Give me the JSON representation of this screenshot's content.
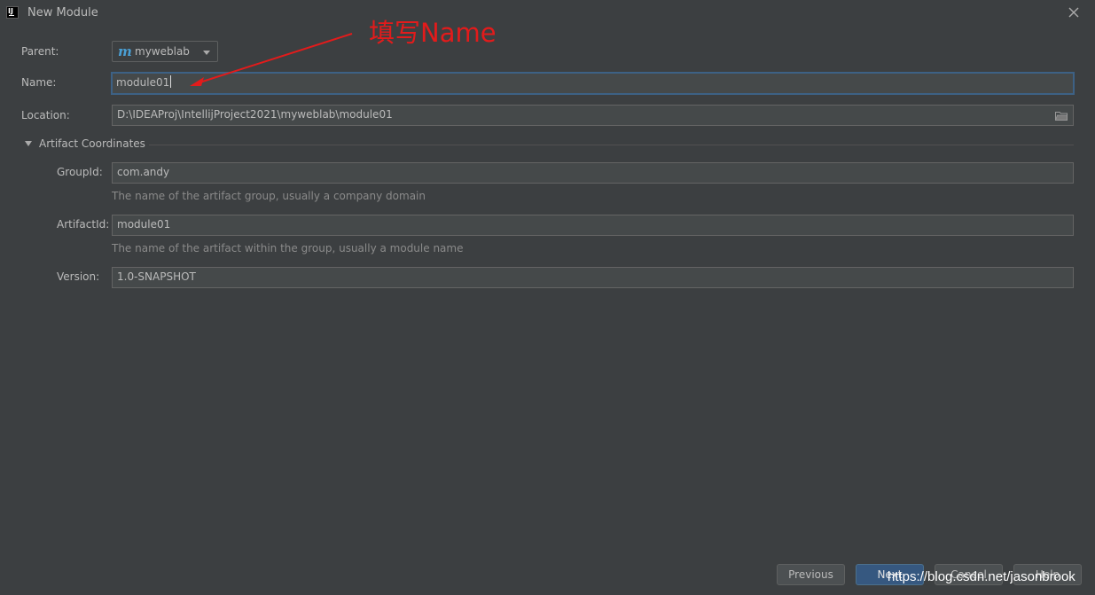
{
  "window": {
    "title": "New Module",
    "icon": "intellij-app-icon",
    "icon_text": "IJ"
  },
  "form": {
    "parent": {
      "label": "Parent:",
      "value": "myweblab"
    },
    "name": {
      "label": "Name:",
      "value": "module01"
    },
    "location": {
      "label": "Location:",
      "value": "D:\\IDEAProj\\IntellijProject2021\\myweblab\\module01"
    }
  },
  "artifact": {
    "section_title": "Artifact Coordinates",
    "group_id": {
      "label": "GroupId:",
      "value": "com.andy",
      "hint": "The name of the artifact group, usually a company domain"
    },
    "artifact_id": {
      "label": "ArtifactId:",
      "value": "module01",
      "hint": "The name of the artifact within the group, usually a module name"
    },
    "version": {
      "label": "Version:",
      "value": "1.0-SNAPSHOT"
    }
  },
  "buttons": {
    "previous": "Previous",
    "next": "Next",
    "cancel": "Cancel",
    "help": "Help"
  },
  "annotation": {
    "text": "填写Name",
    "color": "#e31b1b"
  },
  "watermark": "https://blog.csdn.net/jasonbrook",
  "colors": {
    "background": "#3c3f41",
    "field_background": "#45494a",
    "focus_border": "#3d6185",
    "primary_button": "#365880",
    "maven_icon": "#4a9fd4"
  }
}
